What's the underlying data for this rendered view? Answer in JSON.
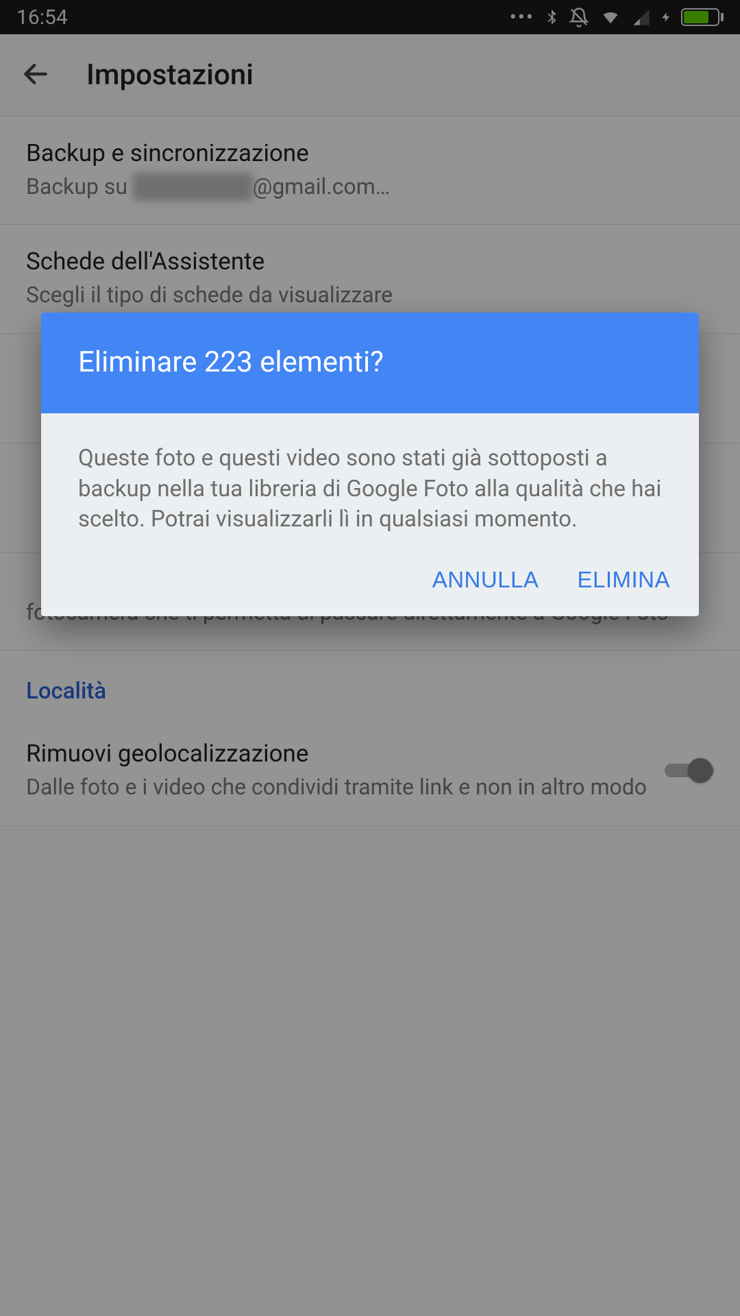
{
  "status": {
    "time": "16:54"
  },
  "appbar": {
    "title": "Impostazioni"
  },
  "settings": {
    "backup": {
      "title": "Backup e sincronizzazione",
      "sub_prefix": "Backup su ",
      "sub_suffix": "@gmail.com…"
    },
    "assistant": {
      "title": "Schede dell'Assistente",
      "sub": "Scegli il tipo di schede da visualizzare"
    },
    "camera_shortcut": {
      "sub": "fotocamera che ti permetta di passare direttamente a Google Foto"
    },
    "section_location": "Località",
    "geoloc": {
      "title": "Rimuovi geolocalizzazione",
      "sub": "Dalle foto e i video che condividi tramite link e non in altro modo"
    }
  },
  "dialog": {
    "title": "Eliminare 223 elementi?",
    "body": "Queste foto e questi video sono stati già sottoposti a backup nella tua libreria di Google Foto alla qualità che hai scelto. Potrai visualizzarli lì in qualsiasi momento.",
    "cancel": "ANNULLA",
    "confirm": "ELIMINA"
  }
}
